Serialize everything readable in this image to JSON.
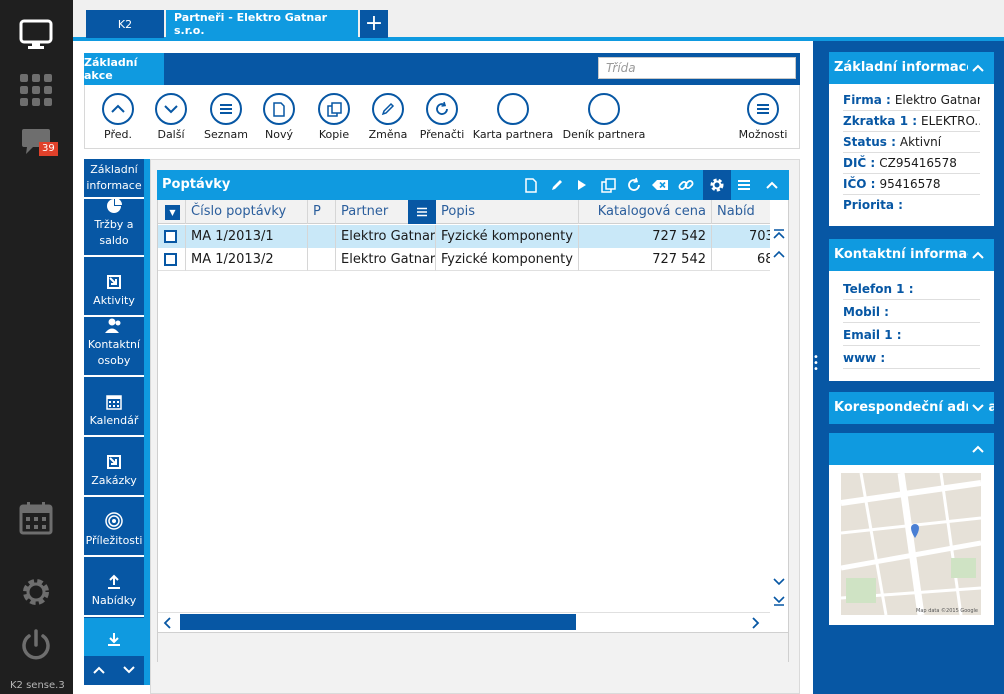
{
  "rail": {
    "items": [
      "desktop-icon",
      "apps-grid-icon",
      "chat-icon",
      "calendar-icon",
      "settings-icon",
      "power-icon"
    ],
    "chat_badge": "39",
    "version": "K2 sense.3"
  },
  "tabs": [
    {
      "label": "K2"
    },
    {
      "label": "Partneři - Elektro Gatnar s.r.o."
    },
    {
      "label": "+"
    }
  ],
  "toolbar": {
    "basic_actions": "Základní akce",
    "class_placeholder": "Třída",
    "actions": [
      {
        "label": "Před.",
        "icon": "chevron-up-icon"
      },
      {
        "label": "Další",
        "icon": "chevron-down-icon"
      },
      {
        "label": "Seznam",
        "icon": "list-icon"
      },
      {
        "label": "Nový",
        "icon": "new-document-icon"
      },
      {
        "label": "Kopie",
        "icon": "copy-icon"
      },
      {
        "label": "Změna",
        "icon": "pencil-icon"
      },
      {
        "label": "Přenačti",
        "icon": "refresh-icon"
      },
      {
        "label": "Karta partnera",
        "icon": "circle-icon"
      },
      {
        "label": "Deník partnera",
        "icon": "circle-icon"
      },
      {
        "label": "Možnosti",
        "icon": "menu-icon"
      }
    ]
  },
  "subnav": {
    "items": [
      {
        "label": "Základní informace"
      },
      {
        "label": "Tržby a saldo",
        "icon": "pie-chart-icon"
      },
      {
        "label": "Aktivity",
        "icon": "link-out-icon"
      },
      {
        "label": "Kontaktní osoby",
        "icon": "people-icon"
      },
      {
        "label": "Kalendář",
        "icon": "calendar-icon"
      },
      {
        "label": "Zakázky",
        "icon": "link-out-icon"
      },
      {
        "label": "Příležitosti",
        "icon": "target-icon"
      },
      {
        "label": "Nabídky",
        "icon": "upload-icon"
      },
      {
        "label": "",
        "icon": "download-icon"
      }
    ]
  },
  "grid": {
    "title": "Poptávky",
    "columns": [
      "Číslo poptávky",
      "P",
      "Partner",
      "Popis",
      "Katalogová cena",
      "Nabíd"
    ],
    "rows": [
      {
        "number": "MA 1/2013/1",
        "p": "",
        "partner": "Elektro Gatnar",
        "description": "Fyzické komponenty",
        "catalog_price": "727 542",
        "offer": "703"
      },
      {
        "number": "MA 1/2013/2",
        "p": "",
        "partner": "Elektro Gatnar",
        "description": "Fyzické komponenty",
        "catalog_price": "727 542",
        "offer": "68"
      }
    ]
  },
  "right_panel": {
    "basic_info": {
      "title": "Základní informace",
      "fields": [
        {
          "label": "Firma :",
          "value": "Elektro Gatnar..."
        },
        {
          "label": "Zkratka 1 :",
          "value": "ELEKTRO..."
        },
        {
          "label": "Status :",
          "value": "Aktivní"
        },
        {
          "label": "DIČ :",
          "value": "CZ95416578"
        },
        {
          "label": "IČO :",
          "value": "95416578"
        },
        {
          "label": "Priorita :",
          "value": ""
        }
      ]
    },
    "contact_info": {
      "title": "Kontaktní informace",
      "fields": [
        {
          "label": "Telefon 1 :",
          "value": ""
        },
        {
          "label": "Mobil :",
          "value": ""
        },
        {
          "label": "Email 1 :",
          "value": ""
        },
        {
          "label": "www :",
          "value": ""
        }
      ]
    },
    "correspondence": {
      "title": "Korespondeční adresa"
    },
    "map_section": {
      "title": "",
      "map_caption": "Map data ©2015 Google"
    }
  },
  "colors": {
    "dark_blue": "#0757a4",
    "light_blue": "#0f9ae0",
    "rail": "#1f1f1f",
    "selected_row": "#c9e8f8",
    "badge": "#e0412b"
  }
}
